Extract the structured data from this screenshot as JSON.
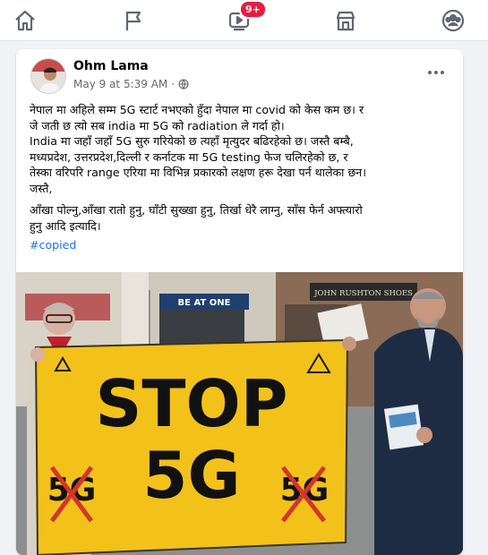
{
  "nav": {
    "items": [
      {
        "name": "home",
        "icon": "home-icon"
      },
      {
        "name": "pages",
        "icon": "flag-icon"
      },
      {
        "name": "watch",
        "icon": "video-icon",
        "badge": "9+"
      },
      {
        "name": "marketplace",
        "icon": "shop-icon"
      },
      {
        "name": "groups",
        "icon": "groups-icon"
      }
    ],
    "active_color": "#606770"
  },
  "post": {
    "author": "Ohm Lama",
    "timestamp": "May 9 at 5:39 AM · ",
    "privacy_icon": "globe-icon",
    "paragraph1_line1": "नेपाल मा अहिले सम्म 5G स्टार्ट नभएको हुँदा नेपाल मा covid को केस कम छ। र",
    "paragraph1_line2": "जे जती छ त्यो सब india मा 5G को radiation ले गर्दा हो।",
    "paragraph2_line1": "India मा जहाँ जहाँ 5G सुरु गरियेको छ त्यहाँ मृत्युदर बढिरहेको छ। जस्तै बम्बै,",
    "paragraph2_line2": "मध्यप्रदेश, उत्तरप्रदेश,दिल्ली र कर्नाटक मा 5G testing फेज चलिरहेको छ, र",
    "paragraph2_line3": "तेस्का वरिपरि range एरिया मा विभिन्न प्रकारको लक्षण हरू देखा पर्न थालेका छन।",
    "paragraph2_line4": "जस्तै,",
    "paragraph3_line1": "आँखा पोल्नु,आँखा रातो हुनु, घाँटी सुख्खा हुनु, तिर्खा धेरै लाग्नु, साँस फेर्न अफ्त्यारो",
    "paragraph3_line2": "हुनु आदि इत्यादि।",
    "hashtag": "#copied"
  },
  "photo": {
    "banner_text_1": "STOP",
    "banner_text_2": "5G",
    "crossed_left": "5G",
    "crossed_right": "5G",
    "shop_sign_1": "BE AT ONE",
    "shop_sign_2": "JOHN RUSHTON SHOES",
    "banner_color": "#f2c21a",
    "cross_color": "#d4352c"
  }
}
